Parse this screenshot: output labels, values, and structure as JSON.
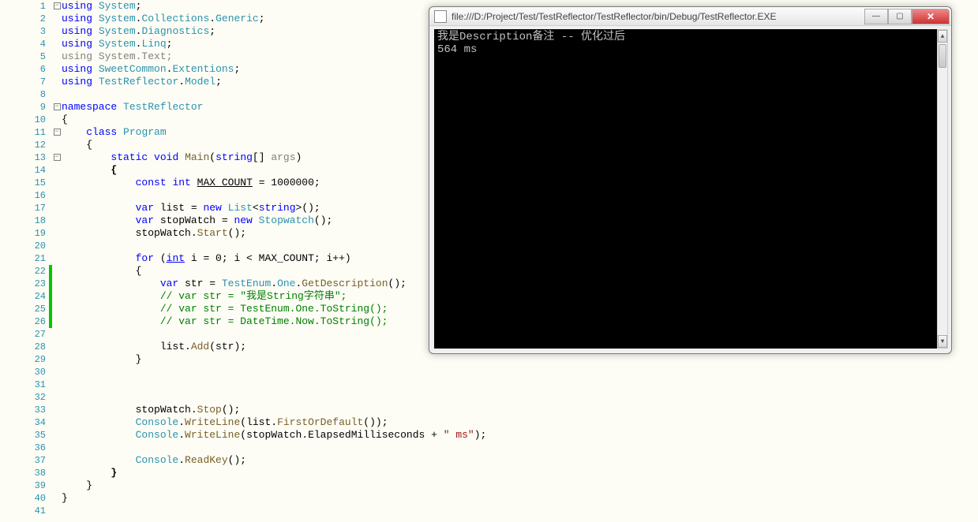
{
  "editor": {
    "lines": [
      {
        "n": 1,
        "fold": "-",
        "tokens": [
          [
            "kw",
            "using"
          ],
          [
            "punct",
            " "
          ],
          [
            "type",
            "System"
          ],
          [
            "punct",
            ";"
          ]
        ]
      },
      {
        "n": 2,
        "tokens": [
          [
            "kw",
            "using"
          ],
          [
            "punct",
            " "
          ],
          [
            "type",
            "System"
          ],
          [
            "punct",
            "."
          ],
          [
            "type",
            "Collections"
          ],
          [
            "punct",
            "."
          ],
          [
            "type",
            "Generic"
          ],
          [
            "punct",
            ";"
          ]
        ]
      },
      {
        "n": 3,
        "tokens": [
          [
            "kw",
            "using"
          ],
          [
            "punct",
            " "
          ],
          [
            "type",
            "System"
          ],
          [
            "punct",
            "."
          ],
          [
            "type",
            "Diagnostics"
          ],
          [
            "punct",
            ";"
          ]
        ]
      },
      {
        "n": 4,
        "tokens": [
          [
            "kw",
            "using"
          ],
          [
            "punct",
            " "
          ],
          [
            "type",
            "System"
          ],
          [
            "punct",
            "."
          ],
          [
            "type",
            "Linq"
          ],
          [
            "punct",
            ";"
          ]
        ]
      },
      {
        "n": 5,
        "tokens": [
          [
            "param",
            "using System.Text;"
          ]
        ]
      },
      {
        "n": 6,
        "tokens": [
          [
            "kw",
            "using"
          ],
          [
            "punct",
            " "
          ],
          [
            "type",
            "SweetCommon"
          ],
          [
            "punct",
            "."
          ],
          [
            "type",
            "Extentions"
          ],
          [
            "punct",
            ";"
          ]
        ]
      },
      {
        "n": 7,
        "tokens": [
          [
            "kw",
            "using"
          ],
          [
            "punct",
            " "
          ],
          [
            "type",
            "TestReflector"
          ],
          [
            "punct",
            "."
          ],
          [
            "type",
            "Model"
          ],
          [
            "punct",
            ";"
          ]
        ]
      },
      {
        "n": 8,
        "tokens": []
      },
      {
        "n": 9,
        "fold": "-",
        "tokens": [
          [
            "kw",
            "namespace"
          ],
          [
            "punct",
            " "
          ],
          [
            "type",
            "TestReflector"
          ]
        ]
      },
      {
        "n": 10,
        "tokens": [
          [
            "punct",
            "{"
          ]
        ]
      },
      {
        "n": 11,
        "fold": "-",
        "tokens": [
          [
            "punct",
            "    "
          ],
          [
            "kw",
            "class"
          ],
          [
            "punct",
            " "
          ],
          [
            "type",
            "Program"
          ]
        ]
      },
      {
        "n": 12,
        "tokens": [
          [
            "punct",
            "    {"
          ]
        ]
      },
      {
        "n": 13,
        "fold": "-",
        "tokens": [
          [
            "punct",
            "        "
          ],
          [
            "kw",
            "static"
          ],
          [
            "punct",
            " "
          ],
          [
            "kw",
            "void"
          ],
          [
            "punct",
            " "
          ],
          [
            "method",
            "Main"
          ],
          [
            "punct",
            "("
          ],
          [
            "kw",
            "string"
          ],
          [
            "punct",
            "[] "
          ],
          [
            "param",
            "args"
          ],
          [
            "punct",
            ")"
          ]
        ]
      },
      {
        "n": 14,
        "tokens": [
          [
            "punct",
            "        "
          ],
          [
            "bold",
            "{"
          ]
        ]
      },
      {
        "n": 15,
        "tokens": [
          [
            "punct",
            "            "
          ],
          [
            "kw",
            "const"
          ],
          [
            "punct",
            " "
          ],
          [
            "kw",
            "int"
          ],
          [
            "punct",
            " "
          ],
          [
            "under",
            "MAX_COUNT"
          ],
          [
            "punct",
            " = 1000000;"
          ]
        ]
      },
      {
        "n": 16,
        "tokens": []
      },
      {
        "n": 17,
        "tokens": [
          [
            "punct",
            "            "
          ],
          [
            "kw",
            "var"
          ],
          [
            "punct",
            " list = "
          ],
          [
            "kw",
            "new"
          ],
          [
            "punct",
            " "
          ],
          [
            "type",
            "List"
          ],
          [
            "punct",
            "<"
          ],
          [
            "kw",
            "string"
          ],
          [
            "punct",
            ">();"
          ]
        ]
      },
      {
        "n": 18,
        "tokens": [
          [
            "punct",
            "            "
          ],
          [
            "kw",
            "var"
          ],
          [
            "punct",
            " stopWatch = "
          ],
          [
            "kw",
            "new"
          ],
          [
            "punct",
            " "
          ],
          [
            "type",
            "Stopwatch"
          ],
          [
            "punct",
            "();"
          ]
        ]
      },
      {
        "n": 19,
        "tokens": [
          [
            "punct",
            "            stopWatch."
          ],
          [
            "method",
            "Start"
          ],
          [
            "punct",
            "();"
          ]
        ]
      },
      {
        "n": 20,
        "tokens": []
      },
      {
        "n": 21,
        "tokens": [
          [
            "punct",
            "            "
          ],
          [
            "kw",
            "for"
          ],
          [
            "punct",
            " ("
          ],
          [
            "underkw",
            "int"
          ],
          [
            "punct",
            " i = 0; i < MAX_COUNT; i++)"
          ]
        ]
      },
      {
        "n": 22,
        "change": true,
        "tokens": [
          [
            "punct",
            "            {"
          ]
        ]
      },
      {
        "n": 23,
        "change": true,
        "tokens": [
          [
            "punct",
            "                "
          ],
          [
            "kw",
            "var"
          ],
          [
            "punct",
            " str = "
          ],
          [
            "type",
            "TestEnum"
          ],
          [
            "punct",
            "."
          ],
          [
            "type",
            "One"
          ],
          [
            "punct",
            "."
          ],
          [
            "method",
            "GetDescription"
          ],
          [
            "punct",
            "();"
          ]
        ]
      },
      {
        "n": 24,
        "change": true,
        "tokens": [
          [
            "punct",
            "                "
          ],
          [
            "comment",
            "// var str = \"我是String字符串\";"
          ]
        ]
      },
      {
        "n": 25,
        "change": true,
        "tokens": [
          [
            "punct",
            "                "
          ],
          [
            "comment",
            "// var str = TestEnum.One.ToString();"
          ]
        ]
      },
      {
        "n": 26,
        "change": true,
        "tokens": [
          [
            "punct",
            "                "
          ],
          [
            "comment",
            "// var str = DateTime.Now.ToString();"
          ]
        ]
      },
      {
        "n": 27,
        "tokens": []
      },
      {
        "n": 28,
        "tokens": [
          [
            "punct",
            "                list."
          ],
          [
            "method",
            "Add"
          ],
          [
            "punct",
            "(str);"
          ]
        ]
      },
      {
        "n": 29,
        "tokens": [
          [
            "punct",
            "            }"
          ]
        ]
      },
      {
        "n": 30,
        "tokens": []
      },
      {
        "n": 31,
        "tokens": []
      },
      {
        "n": 32,
        "tokens": []
      },
      {
        "n": 33,
        "tokens": [
          [
            "punct",
            "            stopWatch."
          ],
          [
            "method",
            "Stop"
          ],
          [
            "punct",
            "();"
          ]
        ]
      },
      {
        "n": 34,
        "tokens": [
          [
            "punct",
            "            "
          ],
          [
            "type",
            "Console"
          ],
          [
            "punct",
            "."
          ],
          [
            "method",
            "WriteLine"
          ],
          [
            "punct",
            "(list."
          ],
          [
            "method",
            "FirstOrDefault"
          ],
          [
            "punct",
            "());"
          ]
        ]
      },
      {
        "n": 35,
        "tokens": [
          [
            "punct",
            "            "
          ],
          [
            "type",
            "Console"
          ],
          [
            "punct",
            "."
          ],
          [
            "method",
            "WriteLine"
          ],
          [
            "punct",
            "(stopWatch.ElapsedMilliseconds + "
          ],
          [
            "str",
            "\" ms\""
          ],
          [
            "punct",
            ");"
          ]
        ]
      },
      {
        "n": 36,
        "tokens": []
      },
      {
        "n": 37,
        "tokens": [
          [
            "punct",
            "            "
          ],
          [
            "type",
            "Console"
          ],
          [
            "punct",
            "."
          ],
          [
            "method",
            "ReadKey"
          ],
          [
            "punct",
            "();"
          ]
        ]
      },
      {
        "n": 38,
        "tokens": [
          [
            "punct",
            "        "
          ],
          [
            "bold",
            "}"
          ]
        ]
      },
      {
        "n": 39,
        "tokens": [
          [
            "punct",
            "    }"
          ]
        ]
      },
      {
        "n": 40,
        "tokens": [
          [
            "punct",
            "}"
          ]
        ]
      },
      {
        "n": 41,
        "tokens": []
      }
    ]
  },
  "console": {
    "title": "file:///D:/Project/Test/TestReflector/TestReflector/bin/Debug/TestReflector.EXE",
    "lines": [
      "我是Description备注 -- 优化过后",
      "564 ms"
    ]
  },
  "window_buttons": {
    "minimize": "—",
    "maximize": "▢",
    "close": "✕"
  }
}
